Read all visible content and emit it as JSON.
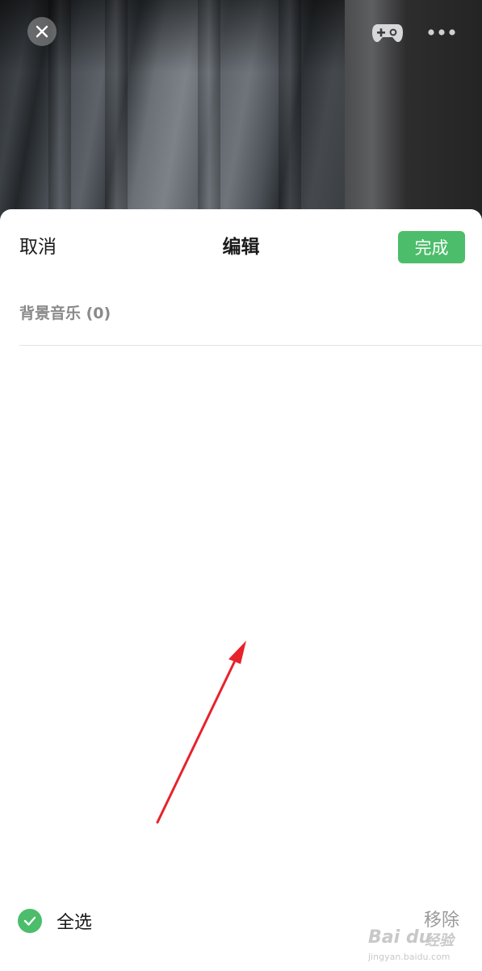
{
  "header": {
    "cancel_label": "取消",
    "title": "编辑",
    "done_label": "完成"
  },
  "section": {
    "label": "背景音乐 (0)"
  },
  "footer": {
    "select_all_label": "全选",
    "remove_label": "移除"
  },
  "watermark": {
    "logo": "Bai du",
    "cn": "经验",
    "url": "jingyan.baidu.com"
  },
  "icons": {
    "close": "close-icon",
    "game": "gamepad-icon",
    "more": "more-icon",
    "check": "check-icon"
  },
  "colors": {
    "accent_green": "#4cbd6a",
    "annotation_arrow": "#e8222b"
  }
}
